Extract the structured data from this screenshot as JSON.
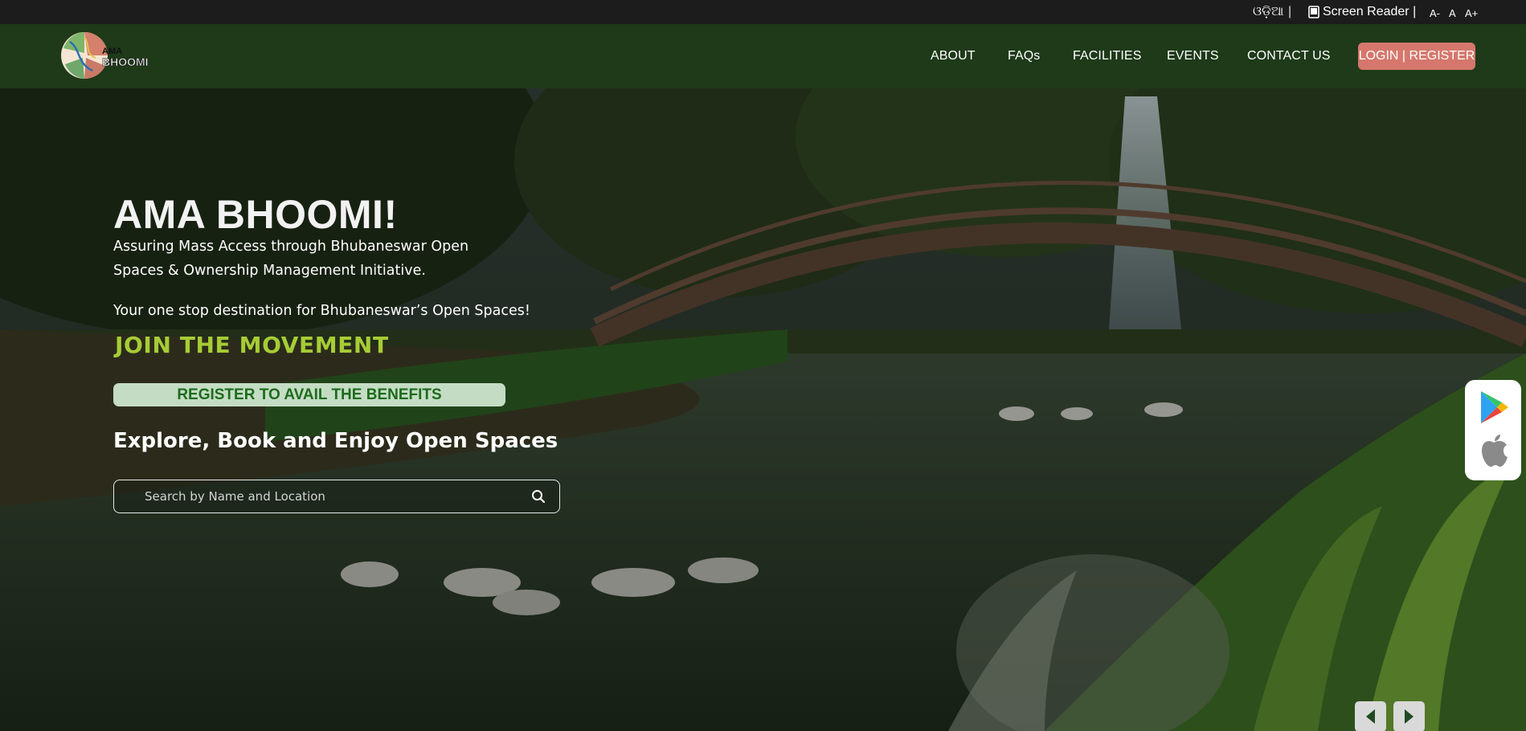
{
  "topbar": {
    "language_label": "ଓଡ଼ିଆ",
    "separator": "|",
    "screen_reader_label": "Screen Reader |",
    "font_decrease": "A-",
    "font_normal": "A",
    "font_increase": "A+"
  },
  "logo": {
    "line1": "AMA",
    "line2": "BHOOMI"
  },
  "nav": {
    "items": [
      {
        "label": "ABOUT"
      },
      {
        "label": "FAQs"
      },
      {
        "label": "FACILITIES"
      },
      {
        "label": "EVENTS"
      },
      {
        "label": "CONTACT US"
      }
    ],
    "login_label": "LOGIN | REGISTER"
  },
  "hero": {
    "title": "AMA BHOOMI!",
    "subtitle": "Assuring Mass Access through Bhubaneswar Open Spaces & Ownership Management Initiative.",
    "destination": "Your one stop destination for Bhubaneswar’s Open Spaces!",
    "join_label": "JOIN THE MOVEMENT",
    "register_label": "REGISTER TO AVAIL THE BENEFITS",
    "explore_heading": "Explore, Book and Enjoy Open Spaces",
    "search_placeholder": "Search by Name and Location"
  },
  "apps": {
    "icons": [
      "google-play-icon",
      "apple-icon"
    ]
  },
  "slider": {
    "prev_icon": "chevron-left-icon",
    "next_icon": "chevron-right-icon"
  },
  "colors": {
    "topbar_bg": "#1c1c1c",
    "nav_bg": "#1e3a19",
    "login_bg": "#d5776c",
    "join_text": "#a6cc35",
    "register_bg": "#c4dcc4",
    "register_text": "#1d6b1c"
  }
}
